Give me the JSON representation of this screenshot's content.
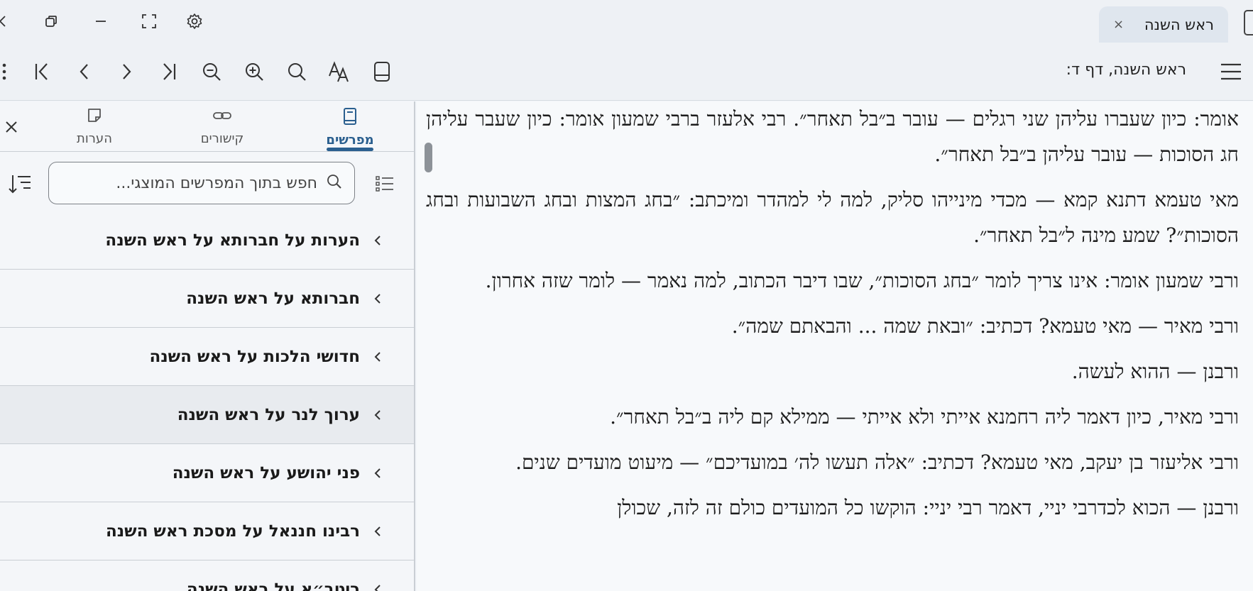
{
  "window": {
    "tab_title": "ראש השנה",
    "tab_close": "×"
  },
  "toolbar": {
    "location": "ראש השנה, דף ד:"
  },
  "sidebar": {
    "tabs": [
      {
        "label": "מפרשים",
        "icon": "book-icon",
        "active": true
      },
      {
        "label": "קישורים",
        "icon": "link-icon",
        "active": false
      },
      {
        "label": "הערות",
        "icon": "note-icon",
        "active": false
      }
    ],
    "search": {
      "placeholder": "חפש בתוך המפרשים המוצגי..."
    },
    "items": [
      {
        "label": "הערות על חברותא על ראש השנה"
      },
      {
        "label": "חברותא על ראש השנה"
      },
      {
        "label": "חדושי הלכות על ראש השנה"
      },
      {
        "label": "ערוך לנר על ראש השנה",
        "selected": true
      },
      {
        "label": "פני יהושע על ראש השנה"
      },
      {
        "label": "רבינו חננאל על מסכת ראש השנה"
      },
      {
        "label": "ריטב״א על ראש השנה"
      }
    ]
  },
  "content": {
    "paragraphs": [
      "אומר: כיון שעברו עליהן שני רגלים — עובר ב״בל תאחר״. רבי אלעזר ברבי שמעון אומר: כיון שעבר עליהן חג הסוכות — עובר עליהן ב״בל תאחר״.",
      "מאי טעמא דתנא קמא — מכדי מינייהו סליק, למה לי למהדר ומיכתב: ״בחג המצות ובחג השבועות ובחג הסוכות״? שמע מינה ל״בל תאחר״.",
      "ורבי שמעון אומר: אינו צריך לומר ״בחג הסוכות״, שבו דיבר הכתוב, למה נאמר — לומר שזה אחרון.",
      "ורבי מאיר — מאי טעמא? דכתיב: ״ובאת שמה ... והבאתם שמה״.",
      "ורבנן — ההוא לעשה.",
      "ורבי מאיר, כיון דאמר ליה רחמנא אייתי ולא אייתי — ממילא קם ליה ב״בל תאחר״.",
      "ורבי אליעזר בן יעקב, מאי טעמא? דכתיב: ״אלה תעשו לה׳ במועדיכם״ — מיעוט מועדים שנים.",
      "ורבנן — הכוא לכדרבי יניי, דאמר רבי יניי: הוקשו כל המועדים כולם זה לזה, שכולן"
    ]
  }
}
